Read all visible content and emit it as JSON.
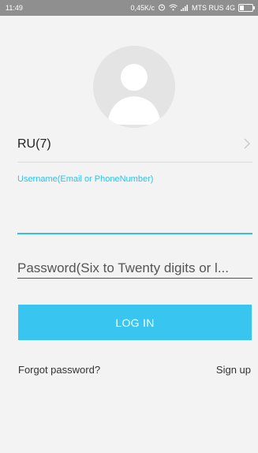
{
  "status_bar": {
    "time": "11:49",
    "speed": "0,45K/c",
    "carrier": "MTS RUS 4G",
    "battery_level": 0.35
  },
  "avatar": {
    "icon": "user-silhouette-icon"
  },
  "country": {
    "label": "RU(7)",
    "chevron_icon": "chevron-right-icon"
  },
  "username": {
    "label": "Username(Email or PhoneNumber)",
    "value": ""
  },
  "password": {
    "placeholder": "Password(Six to Twenty digits or l..."
  },
  "login": {
    "label": "LOG IN"
  },
  "links": {
    "forgot": "Forgot password?",
    "signup": "Sign up"
  },
  "colors": {
    "accent": "#33c1e6",
    "button": "#38c6f0",
    "background": "#f3f3f3"
  }
}
